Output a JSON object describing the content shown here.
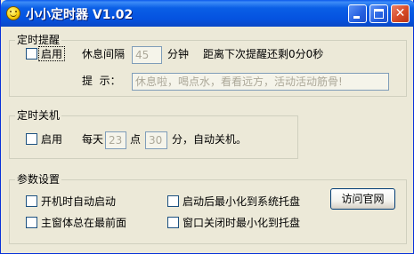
{
  "window": {
    "title": "小小定时器 V1.02",
    "close_glyph": "✕"
  },
  "reminder": {
    "group_title": "定时提醒",
    "enable_label": "启用",
    "interval_label": "休息间隔",
    "interval_value": "45",
    "interval_unit": "分钟",
    "countdown_text": "距离下次提醒还剩0分0秒",
    "tip_label": "提  示：",
    "tip_value": "休息啦，喝点水，看看远方，活动活动筋骨!"
  },
  "shutdown": {
    "group_title": "定时关机",
    "enable_label": "启用",
    "daily_label": "每天",
    "hour_value": "23",
    "hour_unit": "点",
    "minute_value": "30",
    "minute_suffix": "分，自动关机。"
  },
  "settings": {
    "group_title": "参数设置",
    "autostart_label": "开机时自动启动",
    "minimize_on_start_label": "启动后最小化到系统托盘",
    "always_on_top_label": "主窗体总在最前面",
    "minimize_on_close_label": "窗口关闭时最小化到托盘",
    "visit_button_label": "访问官网"
  }
}
